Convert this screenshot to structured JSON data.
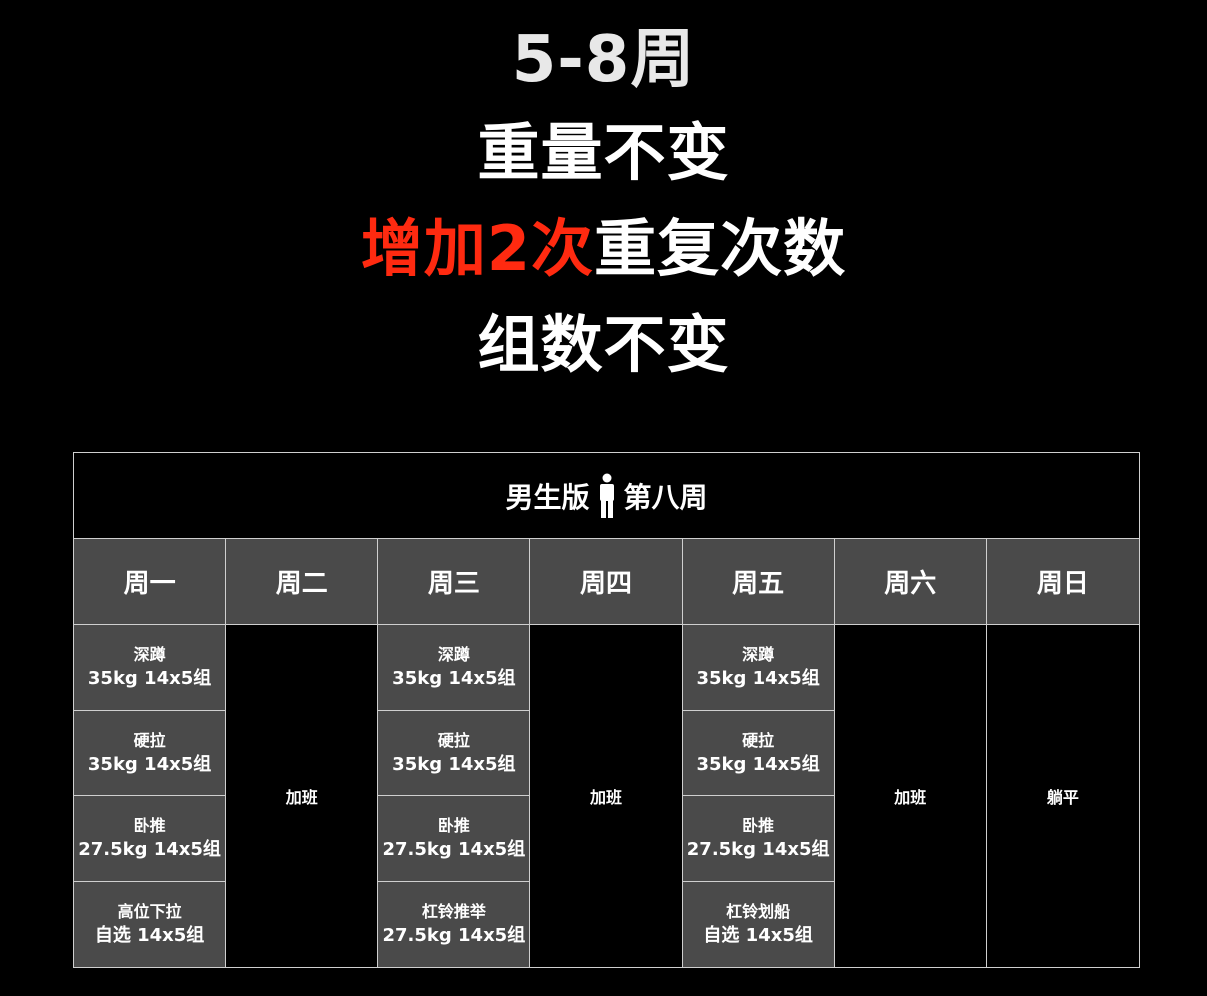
{
  "headline": {
    "line1": "5-8周",
    "line2": "重量不变",
    "line3_highlight": "增加2次",
    "line3_rest": "重复次数",
    "line4": "组数不变",
    "highlight_color": "#ff2a10"
  },
  "schedule": {
    "title_left": "男生版",
    "title_icon": "person-icon",
    "title_right": "第八周",
    "days": [
      "周一",
      "周二",
      "周三",
      "周四",
      "周五",
      "周六",
      "周日"
    ],
    "monday": [
      {
        "name": "深蹲",
        "detail": "35kg 14x5组"
      },
      {
        "name": "硬拉",
        "detail": "35kg 14x5组"
      },
      {
        "name": "卧推",
        "detail": "27.5kg 14x5组"
      },
      {
        "name": "高位下拉",
        "detail": "自选 14x5组"
      }
    ],
    "tuesday": "加班",
    "wednesday": [
      {
        "name": "深蹲",
        "detail": "35kg 14x5组"
      },
      {
        "name": "硬拉",
        "detail": "35kg 14x5组"
      },
      {
        "name": "卧推",
        "detail": "27.5kg 14x5组"
      },
      {
        "name": "杠铃推举",
        "detail": "27.5kg 14x5组"
      }
    ],
    "thursday": "加班",
    "friday": [
      {
        "name": "深蹲",
        "detail": "35kg 14x5组"
      },
      {
        "name": "硬拉",
        "detail": "35kg 14x5组"
      },
      {
        "name": "卧推",
        "detail": "27.5kg 14x5组"
      },
      {
        "name": "杠铃划船",
        "detail": "自选 14x5组"
      }
    ],
    "saturday": "加班",
    "sunday": "躺平"
  }
}
